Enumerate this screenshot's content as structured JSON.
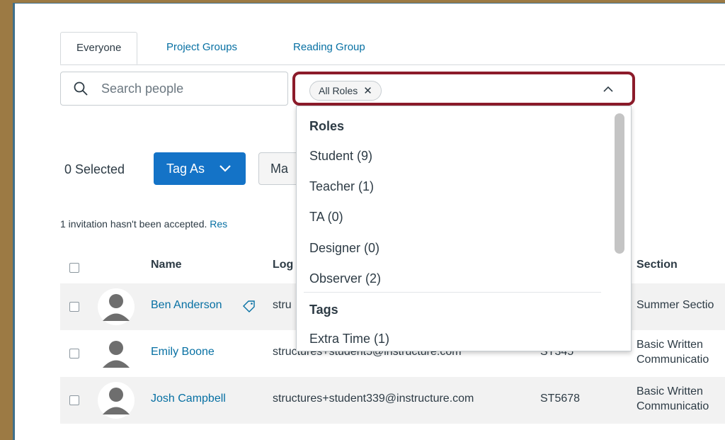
{
  "tabs": [
    "Everyone",
    "Project Groups",
    "Reading Group"
  ],
  "search": {
    "placeholder": "Search people"
  },
  "roles_filter": {
    "chip_label": "All Roles",
    "chip_remove": "✕"
  },
  "dropdown": {
    "roles_heading": "Roles",
    "roles": [
      "Student (9)",
      "Teacher (1)",
      "TA (0)",
      "Designer (0)",
      "Observer (2)"
    ],
    "tags_heading": "Tags",
    "tags": [
      "Extra Time (1)"
    ]
  },
  "toolbar": {
    "selected_count": "0 Selected",
    "tag_as_label": "Tag As",
    "manage_label_partial": "Ma"
  },
  "invitation_notice": {
    "text": "1 invitation hasn't been accepted.",
    "link_partial": "Res"
  },
  "table": {
    "headers": {
      "name": "Name",
      "login_partial": "Log",
      "section": "Section"
    },
    "rows": [
      {
        "name": "Ben Anderson",
        "login": "stru",
        "sis_id": "",
        "section": "Summer Sectio",
        "tagged": true
      },
      {
        "name": "Emily Boone",
        "login": "structures+student5@instructure.com",
        "sis_id": "ST345",
        "section_line1": "Basic Written",
        "section_line2": "Communicatio"
      },
      {
        "name": "Josh Campbell",
        "login": "structures+student339@instructure.com",
        "sis_id": "ST5678",
        "section_line1": "Basic Written",
        "section_line2": "Communicatio"
      }
    ]
  },
  "colors": {
    "accent": "#1473c7",
    "link": "#0770a3",
    "highlight_border": "#8c1b2a",
    "frame_bg": "#9c7a44"
  },
  "icons": [
    "search-icon",
    "close-icon",
    "chevron-up-icon",
    "chevron-down-icon",
    "tag-icon",
    "avatar-icon",
    "checkbox-icon"
  ]
}
